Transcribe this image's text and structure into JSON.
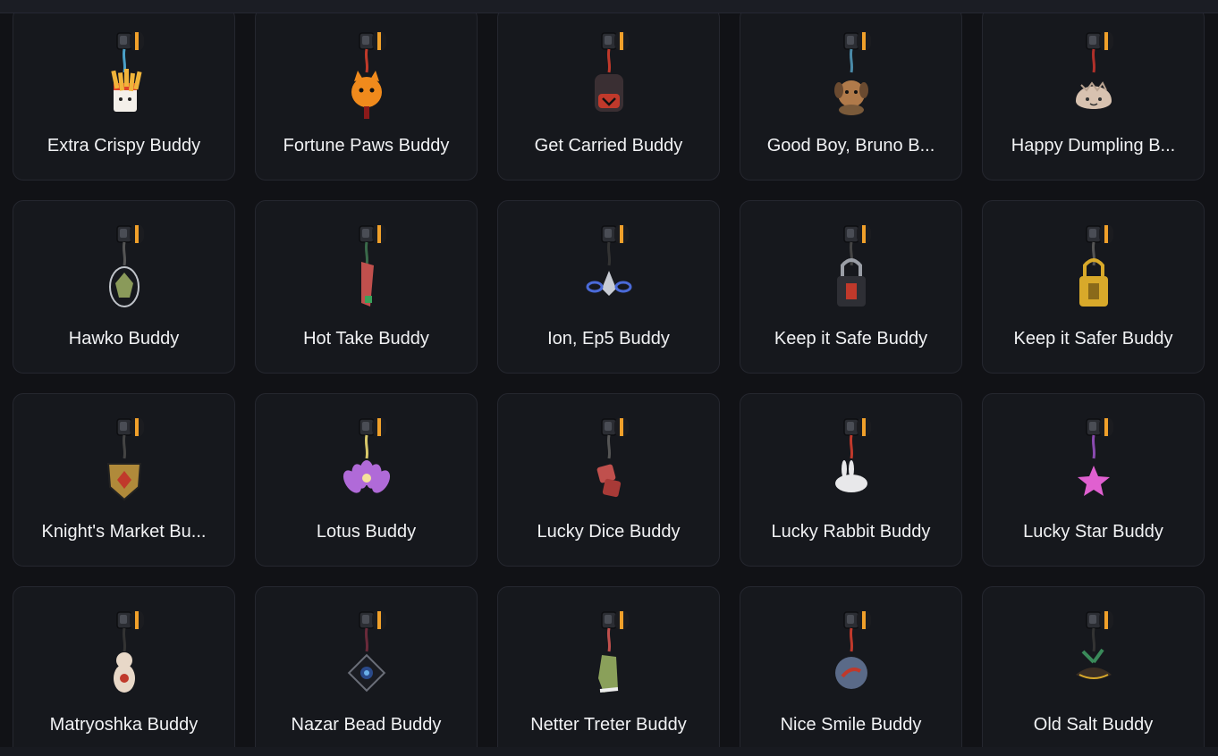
{
  "buddies": [
    {
      "name": "Extra Crispy Buddy",
      "icon": "fries-buddy-icon",
      "color": "#e0442b",
      "strap": "#4aa0c8"
    },
    {
      "name": "Fortune Paws Buddy",
      "icon": "lucky-cat-buddy-icon",
      "color": "#f08a1c",
      "strap": "#c23a2a"
    },
    {
      "name": "Get Carried Buddy",
      "icon": "backpack-buddy-icon",
      "color": "#3a2f33",
      "strap": "#c0392b"
    },
    {
      "name": "Good Boy, Bruno B...",
      "icon": "dog-buddy-icon",
      "color": "#b07a4a",
      "strap": "#4a8aa8"
    },
    {
      "name": "Happy Dumpling B...",
      "icon": "dumpling-buddy-icon",
      "color": "#d8c2b0",
      "strap": "#b0302a"
    },
    {
      "name": "Hawko Buddy",
      "icon": "hawk-buddy-icon",
      "color": "#8a9a5a",
      "strap": "#555555"
    },
    {
      "name": "Hot Take Buddy",
      "icon": "hot-take-buddy-icon",
      "color": "#c0504d",
      "strap": "#3a6a4a"
    },
    {
      "name": "Ion, Ep5 Buddy",
      "icon": "ion-ship-buddy-icon",
      "color": "#c8ccd4",
      "strap": "#333333"
    },
    {
      "name": "Keep it Safe Buddy",
      "icon": "padlock-buddy-icon",
      "color": "#2e2f35",
      "strap": "#444444"
    },
    {
      "name": "Keep it Safer Buddy",
      "icon": "gold-padlock-buddy-icon",
      "color": "#d8a92a",
      "strap": "#555555"
    },
    {
      "name": "Knight's Market Bu...",
      "icon": "shield-buddy-icon",
      "color": "#b08a3a",
      "strap": "#444444"
    },
    {
      "name": "Lotus Buddy",
      "icon": "lotus-buddy-icon",
      "color": "#b06ad8",
      "strap": "#d8c86a"
    },
    {
      "name": "Lucky Dice Buddy",
      "icon": "dice-buddy-icon",
      "color": "#c0504d",
      "strap": "#555555"
    },
    {
      "name": "Lucky Rabbit Buddy",
      "icon": "rabbit-buddy-icon",
      "color": "#e8e8ea",
      "strap": "#c0392b"
    },
    {
      "name": "Lucky Star Buddy",
      "icon": "star-buddy-icon",
      "color": "#e060d0",
      "strap": "#8a4ab0"
    },
    {
      "name": "Matryoshka Buddy",
      "icon": "matryoshka-buddy-icon",
      "color": "#e8d8c8",
      "strap": "#333333"
    },
    {
      "name": "Nazar Bead Buddy",
      "icon": "nazar-bead-buddy-icon",
      "color": "#2a4a8a",
      "strap": "#6a2a3a"
    },
    {
      "name": "Netter Treter Buddy",
      "icon": "sneaker-buddy-icon",
      "color": "#8aa05a",
      "strap": "#c0504d"
    },
    {
      "name": "Nice Smile Buddy",
      "icon": "smile-orb-buddy-icon",
      "color": "#5a6a88",
      "strap": "#c0392b"
    },
    {
      "name": "Old Salt Buddy",
      "icon": "pirate-hat-buddy-icon",
      "color": "#3a2e24",
      "strap": "#333333"
    }
  ]
}
